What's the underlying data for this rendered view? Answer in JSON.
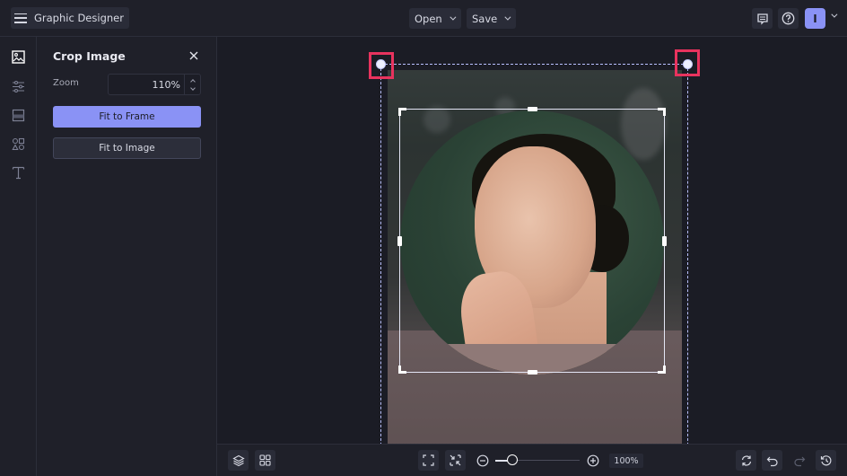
{
  "header": {
    "app_title": "Graphic Designer",
    "menu_icon": "hamburger-icon",
    "open_label": "Open",
    "save_label": "Save",
    "comments_icon": "comment-icon",
    "help_icon": "help-icon",
    "avatar_initial": "I",
    "accent_color": "#8a92f5"
  },
  "rail": {
    "items": [
      {
        "name": "photos",
        "icon": "image-icon",
        "active": true
      },
      {
        "name": "adjust",
        "icon": "sliders-icon",
        "active": false
      },
      {
        "name": "layout",
        "icon": "layout-icon",
        "active": false
      },
      {
        "name": "graphics",
        "icon": "shapes-icon",
        "active": false
      },
      {
        "name": "text",
        "icon": "text-icon",
        "active": false
      }
    ]
  },
  "panel": {
    "title": "Crop Image",
    "zoom_label": "Zoom",
    "zoom_value": "110%",
    "fit_frame_label": "Fit to Frame",
    "fit_image_label": "Fit to Image"
  },
  "canvas": {
    "highlight_color": "#e8335e",
    "frame_color": "#b9c0ff"
  },
  "bottombar": {
    "layers_icon": "layers-icon",
    "grid_icon": "grid-icon",
    "fit_screen_icon": "fullscreen-icon",
    "shrink_icon": "shrink-icon",
    "zoom_out_icon": "zoom-out-icon",
    "zoom_in_icon": "zoom-in-icon",
    "zoom_level": "100%",
    "zoom_slider_fraction": 0.2,
    "refresh_icon": "refresh-icon",
    "undo_icon": "undo-icon",
    "redo_icon": "redo-icon",
    "history_icon": "history-icon"
  }
}
